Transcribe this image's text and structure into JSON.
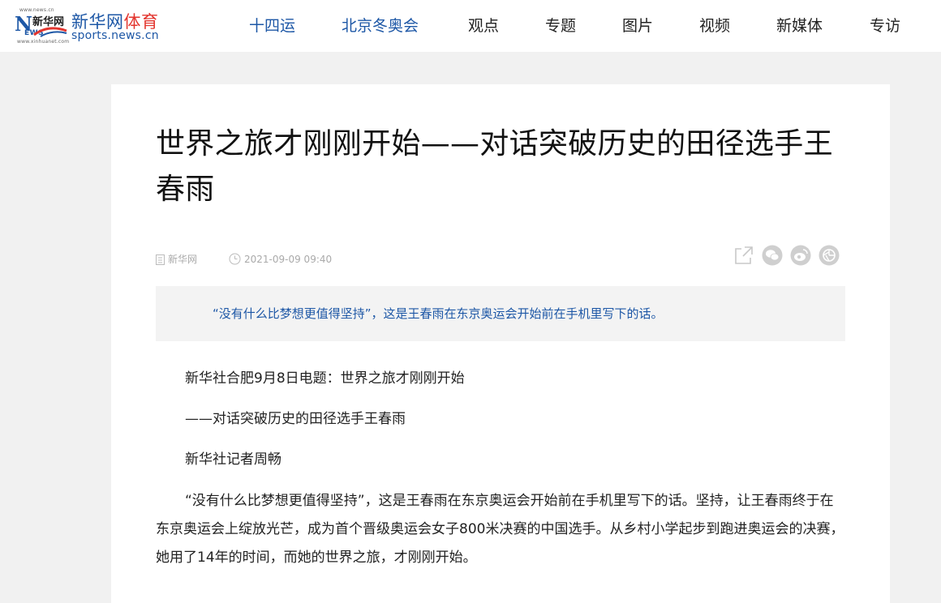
{
  "header": {
    "logo": {
      "small_top": "www.news.cn",
      "badge_cn": "新华网",
      "badge_news": "N",
      "badge_ews": "EWS",
      "small_bottom": "www.xinhuanet.com",
      "title_main": "新华网",
      "title_sport": "体育",
      "url": "sports.news.cn"
    },
    "nav": [
      {
        "label": "十四运"
      },
      {
        "label": "北京冬奥会"
      },
      {
        "label": "观点"
      },
      {
        "label": "专题"
      },
      {
        "label": "图片"
      },
      {
        "label": "视频"
      },
      {
        "label": "新媒体"
      },
      {
        "label": "专访"
      }
    ]
  },
  "article": {
    "title": "世界之旅才刚刚开始——对话突破历史的田径选手王春雨",
    "source": "新华网",
    "time": "2021-09-09 09:40",
    "share_icons": [
      "share-link-icon",
      "wechat-icon",
      "weibo-icon",
      "moments-icon"
    ],
    "summary": "“没有什么比梦想更值得坚持”，这是王春雨在东京奥运会开始前在手机里写下的话。",
    "paragraphs": [
      "新华社合肥9月8日电题：世界之旅才刚刚开始",
      "——对话突破历史的田径选手王春雨",
      "新华社记者周畅",
      "“没有什么比梦想更值得坚持”，这是王春雨在东京奥运会开始前在手机里写下的话。坚持，让王春雨终于在东京奥运会上绽放光芒，成为首个晋级奥运会女子800米决赛的中国选手。从乡村小学起步到跑进奥运会的决赛，她用了14年的时间，而她的世界之旅，才刚刚开始。"
    ]
  },
  "colors": {
    "brand_blue": "#1d57a6",
    "brand_red": "#e3352e",
    "page_bg": "#f1f1f1",
    "summary_bg": "#f3f3f3",
    "meta_gray": "#aaaaaa"
  }
}
